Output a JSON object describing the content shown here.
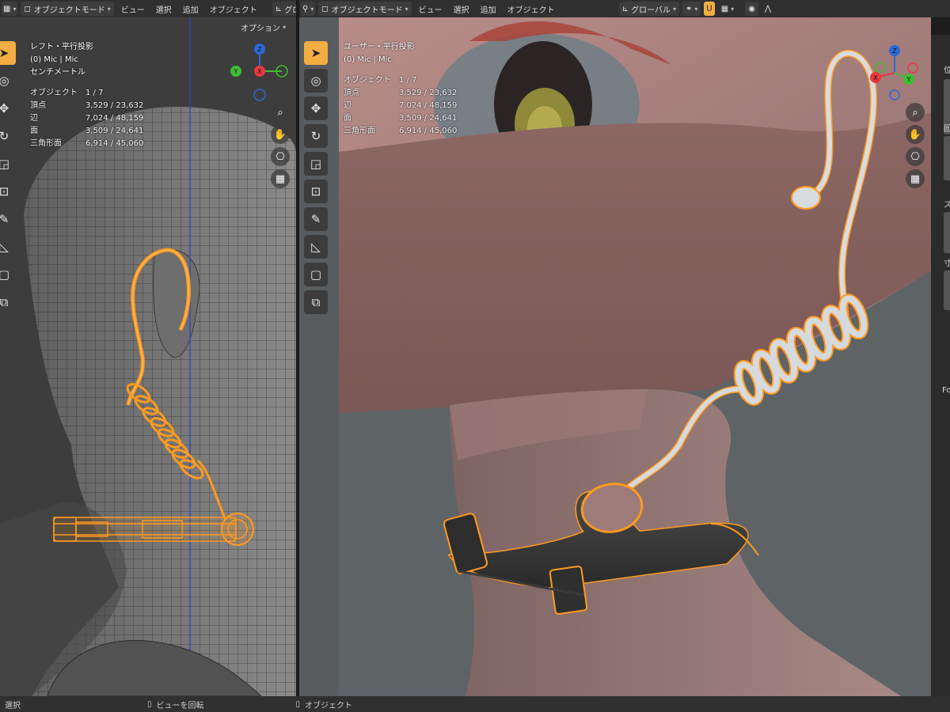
{
  "left_header": {
    "mode": "オブジェクトモード",
    "menus": [
      "ビュー",
      "選択",
      "追加",
      "オブジェクト"
    ],
    "transform": "グロ",
    "options": "オプション"
  },
  "right_header": {
    "mode": "オブジェクトモード",
    "menus": [
      "ビュー",
      "選択",
      "追加",
      "オブジェクト"
    ],
    "orientation": "グローバル"
  },
  "left_view": {
    "view_name": "レフト・平行投影",
    "collection": "(0) Mic | Mic",
    "units": "センチメートル",
    "stats": [
      {
        "label": "オブジェクト",
        "value": "1 / 7"
      },
      {
        "label": "頂点",
        "value": "3,529 / 23,632"
      },
      {
        "label": "辺",
        "value": "7,024 / 48,159"
      },
      {
        "label": "面",
        "value": "3,509 / 24,641"
      },
      {
        "label": "三角形面",
        "value": "6,914 / 45,060"
      }
    ]
  },
  "right_view": {
    "view_name": "ユーザー・平行投影",
    "collection": "(0) Mic | Mic",
    "stats": [
      {
        "label": "オブジェクト",
        "value": "1 / 7"
      },
      {
        "label": "頂点",
        "value": "3,529 / 23,632"
      },
      {
        "label": "辺",
        "value": "7,024 / 48,159"
      },
      {
        "label": "面",
        "value": "3,509 / 24,641"
      },
      {
        "label": "三角形面",
        "value": "6,914 / 45,060"
      }
    ]
  },
  "gizmo_labels": {
    "z": "Z",
    "y": "Y",
    "x": "X"
  },
  "properties_peek": [
    "位",
    "回",
    "ス",
    "寸",
    "Fo"
  ],
  "status_bar": {
    "left": "選択",
    "middle": "ビューを回転",
    "right": "オブジェクト"
  },
  "colors": {
    "accent": "#f2ad43",
    "selection_outline": "#ff9a1f",
    "header_bg": "#303030",
    "axis_x": "#e8383d",
    "axis_y": "#3ebd34",
    "axis_z": "#2d67d8"
  },
  "icons": [
    "editor-type-icon",
    "cursor-select-icon",
    "cursor-3d-icon",
    "move-icon",
    "rotate-icon",
    "scale-icon",
    "transform-icon",
    "annotate-icon",
    "measure-icon",
    "add-cube-icon",
    "add-object-icon",
    "zoom-icon",
    "hand-icon",
    "camera-icon",
    "grid-icon",
    "mouse-icon"
  ]
}
